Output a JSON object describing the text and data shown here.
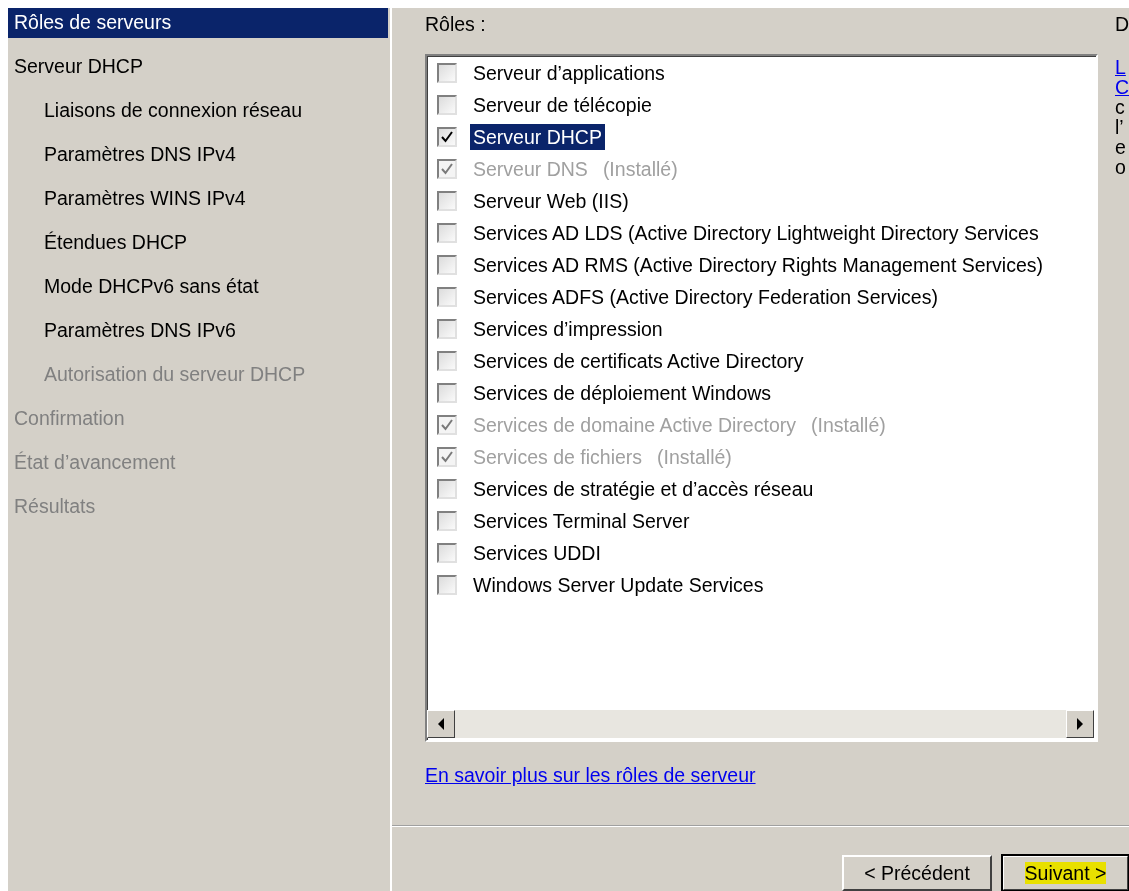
{
  "sidebar": {
    "items": [
      {
        "label": "Rôles de serveurs",
        "selected": true,
        "disabled": false
      },
      {
        "label": "Serveur DHCP",
        "selected": false,
        "disabled": false,
        "children": [
          {
            "label": "Liaisons de connexion réseau",
            "selected": false,
            "disabled": false
          },
          {
            "label": "Paramètres DNS IPv4",
            "selected": false,
            "disabled": false
          },
          {
            "label": "Paramètres WINS IPv4",
            "selected": false,
            "disabled": false
          },
          {
            "label": "Étendues DHCP",
            "selected": false,
            "disabled": false
          },
          {
            "label": "Mode DHCPv6 sans état",
            "selected": false,
            "disabled": false
          },
          {
            "label": "Paramètres DNS IPv6",
            "selected": false,
            "disabled": false
          },
          {
            "label": "Autorisation du serveur DHCP",
            "selected": false,
            "disabled": true
          }
        ]
      },
      {
        "label": "Confirmation",
        "selected": false,
        "disabled": true
      },
      {
        "label": "État d’avancement",
        "selected": false,
        "disabled": true
      },
      {
        "label": "Résultats",
        "selected": false,
        "disabled": true
      }
    ]
  },
  "roles": {
    "label": "Rôles :",
    "items": [
      {
        "label": "Serveur d’applications",
        "checked": false,
        "disabled": false,
        "selected": false
      },
      {
        "label": "Serveur de télécopie",
        "checked": false,
        "disabled": false,
        "selected": false
      },
      {
        "label": "Serveur DHCP",
        "checked": true,
        "disabled": false,
        "selected": true
      },
      {
        "label": "Serveur DNS",
        "note": "(Installé)",
        "checked": true,
        "disabled": true,
        "selected": false
      },
      {
        "label": "Serveur Web (IIS)",
        "checked": false,
        "disabled": false,
        "selected": false
      },
      {
        "label": "Services AD LDS (Active Directory Lightweight Directory Services",
        "checked": false,
        "disabled": false,
        "selected": false
      },
      {
        "label": "Services AD RMS (Active Directory Rights Management Services)",
        "checked": false,
        "disabled": false,
        "selected": false
      },
      {
        "label": "Services ADFS (Active Directory Federation Services)",
        "checked": false,
        "disabled": false,
        "selected": false
      },
      {
        "label": "Services d’impression",
        "checked": false,
        "disabled": false,
        "selected": false
      },
      {
        "label": "Services de certificats Active Directory",
        "checked": false,
        "disabled": false,
        "selected": false
      },
      {
        "label": "Services de déploiement Windows",
        "checked": false,
        "disabled": false,
        "selected": false
      },
      {
        "label": "Services de domaine Active Directory",
        "note": "(Installé)",
        "checked": true,
        "disabled": true,
        "selected": false
      },
      {
        "label": "Services de fichiers",
        "note": "(Installé)",
        "checked": true,
        "disabled": true,
        "selected": false
      },
      {
        "label": "Services de stratégie et d’accès réseau",
        "checked": false,
        "disabled": false,
        "selected": false
      },
      {
        "label": "Services Terminal Server",
        "checked": false,
        "disabled": false,
        "selected": false
      },
      {
        "label": "Services UDDI",
        "checked": false,
        "disabled": false,
        "selected": false
      },
      {
        "label": "Windows Server Update Services",
        "checked": false,
        "disabled": false,
        "selected": false
      }
    ],
    "link": "En savoir plus sur les rôles de serveur"
  },
  "description": {
    "heading": "D",
    "lines": [
      {
        "kind": "link",
        "text": "L"
      },
      {
        "kind": "link",
        "text": "C"
      },
      {
        "kind": "text",
        "text": "c"
      },
      {
        "kind": "text",
        "text": "l’"
      },
      {
        "kind": "text",
        "text": "e"
      },
      {
        "kind": "text",
        "text": "o"
      }
    ]
  },
  "buttons": [
    {
      "label": "< Précédent",
      "default": false,
      "highlighted": false
    },
    {
      "label": "Suivant >",
      "default": true,
      "highlighted": true
    }
  ]
}
